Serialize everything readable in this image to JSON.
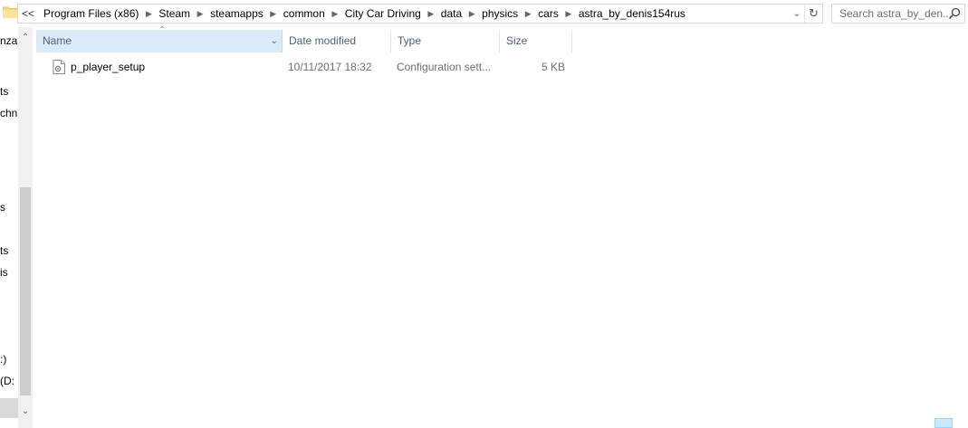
{
  "address_bar": {
    "overflow": "<<",
    "crumbs": [
      "Program Files (x86)",
      "Steam",
      "steamapps",
      "common",
      "City Car Driving",
      "data",
      "physics",
      "cars",
      "astra_by_denis154rus"
    ],
    "dropdown_icon": "chevron-down-icon",
    "refresh_icon": "refresh-icon"
  },
  "search": {
    "placeholder": "Search astra_by_den..."
  },
  "nav_pane": {
    "fragments": [
      "nza",
      "ts",
      "chn",
      "s",
      "ts",
      "is",
      ":)",
      "(D:"
    ]
  },
  "columns": {
    "name": "Name",
    "date": "Date modified",
    "type": "Type",
    "size": "Size"
  },
  "files": [
    {
      "name": "p_player_setup",
      "date": "10/11/2017 18:32",
      "type": "Configuration sett...",
      "size": "5 KB"
    }
  ],
  "colors": {
    "header_selected": "#d9ebf9",
    "header_text": "#4c607a",
    "folder_yellow": "#f8d775"
  }
}
